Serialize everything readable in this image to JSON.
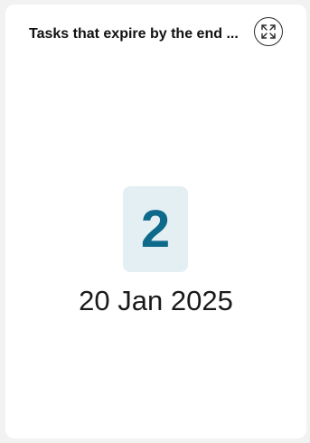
{
  "card": {
    "title": "Tasks that expire by the end ...",
    "expand_icon": "expand-arrows-icon",
    "count": "2",
    "date": "20 Jan 2025"
  },
  "colors": {
    "count_text": "#0e6a8a",
    "count_background": "#e4eff4",
    "card_background": "#ffffff",
    "page_background": "#f2f2f2"
  }
}
